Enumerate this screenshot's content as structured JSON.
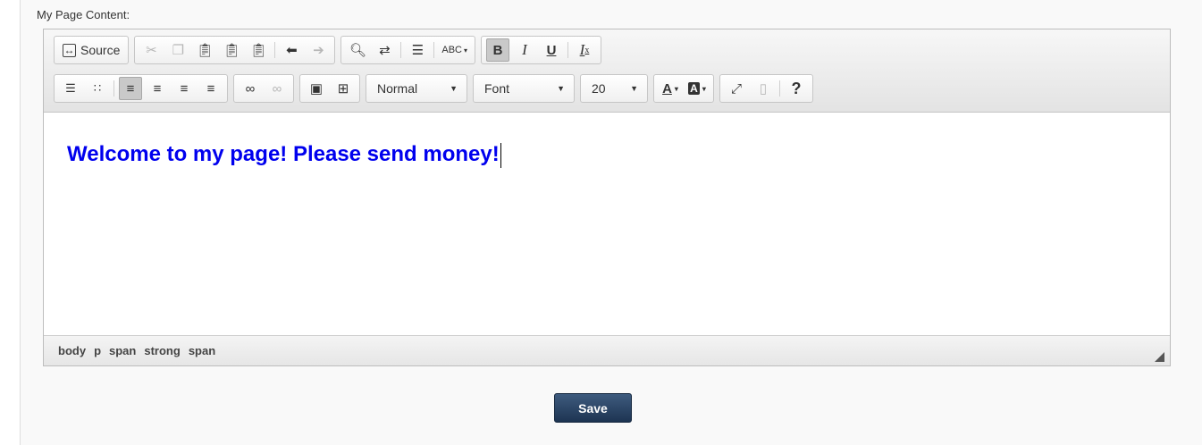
{
  "field_label": "My Page Content:",
  "toolbar": {
    "source_label": "Source",
    "format_value": "Normal",
    "font_value": "Font",
    "size_value": "20",
    "text_color_label": "A",
    "bg_color_label": "A",
    "help_label": "?",
    "bold_label": "B",
    "italic_label": "I",
    "underline_label": "U",
    "remove_format_label": "I",
    "spellcheck_label": "ABC"
  },
  "content": {
    "text": "Welcome to my page! Please send money!",
    "color": "#0000ee"
  },
  "statusbar": {
    "path": [
      "body",
      "p",
      "span",
      "strong",
      "span"
    ]
  },
  "save_label": "Save",
  "colors": {
    "accent": "#2b4566",
    "text_blue": "#0000ee"
  }
}
